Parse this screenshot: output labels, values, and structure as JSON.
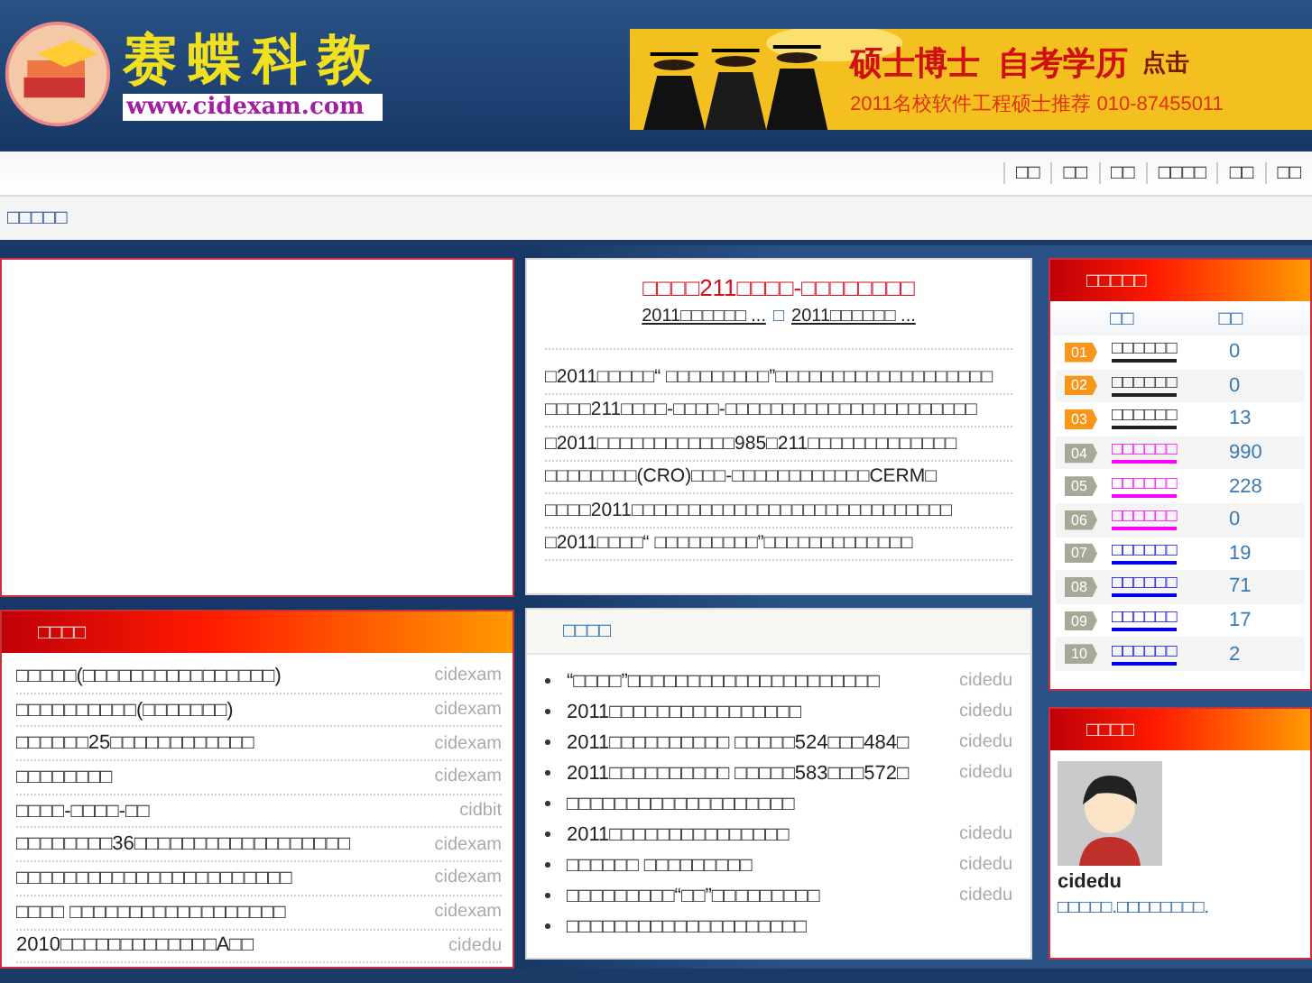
{
  "header": {
    "logo_title": "赛蝶科教",
    "logo_url": "www.cidexam.com",
    "banner": {
      "headline": "硕士博士  自考学历",
      "action": "点击",
      "subline": "2011名校软件工程硕士推荐 010-87455011"
    }
  },
  "nav": [
    "□□",
    "□□",
    "□□",
    "□□□□",
    "□□",
    "□□"
  ],
  "breadcrumb": "□□□□□",
  "article": {
    "title": "□□□□211□□□□-□□□□□□□□",
    "links": [
      "2011□□□□□□ ...",
      "2011□□□□□□ ..."
    ],
    "separator": "□",
    "lines": [
      "□2011□□□□□“ □□□□□□□□□”□□□□□□□□□□□□□□□□□□□",
      "□□□□211□□□□-□□□□-□□□□□□□□□□□□□□□□□□□□□□",
      "□2011□□□□□□□□□□□□985□211□□□□□□□□□□□□□",
      "□□□□□□□□(CRO)□□□-□□□□□□□□□□□□CERM□",
      "□□□□2011□□□□□□□□□□□□□□□□□□□□□□□□□□□□",
      "□2011□□□□“ □□□□□□□□□”□□□□□□□□□□□□□"
    ]
  },
  "left_list": {
    "title": "□□□□",
    "items": [
      {
        "text": "□□□□□(□□□□□□□□□□□□□□□□)",
        "author": "cidexam"
      },
      {
        "text": "□□□□□□□□□□(□□□□□□□)",
        "author": "cidexam"
      },
      {
        "text": "□□□□□□25□□□□□□□□□□□□",
        "author": "cidexam"
      },
      {
        "text": "□□□□□□□□",
        "author": "cidexam"
      },
      {
        "text": "□□□□-□□□□-□□",
        "author": "cidbit"
      },
      {
        "text": "□□□□□□□□36□□□□□□□□□□□□□□□□□□",
        "author": "cidexam"
      },
      {
        "text": "□□□□□□□□□□□□□□□□□□□□□□□",
        "author": "cidexam"
      },
      {
        "text": "□□□□ □□□□□□□□□□□□□□□□□□",
        "author": "cidexam"
      },
      {
        "text": "2010□□□□□□□□□□□□□A□□",
        "author": "cidedu"
      }
    ]
  },
  "news": {
    "title": "□□□□",
    "items": [
      {
        "text": "“□□□□”□□□□□□□□□□□□□□□□□□□□□",
        "author": "cidedu"
      },
      {
        "text": "2011□□□□□□□□□□□□□□□□",
        "author": "cidedu"
      },
      {
        "text": "2011□□□□□□□□□□ □□□□□524□□□484□",
        "author": "cidedu"
      },
      {
        "text": "2011□□□□□□□□□□ □□□□□583□□□572□",
        "author": "cidedu"
      },
      {
        "text": "□□□□□□□□□□□□□□□□□□□"
      },
      {
        "text": "2011□□□□□□□□□□□□□□□",
        "author": "cidedu"
      },
      {
        "text": "□□□□□□ □□□□□□□□□",
        "author": "cidedu"
      },
      {
        "text": "□□□□□□□□□“□□”□□□□□□□□□",
        "author": "cidedu"
      },
      {
        "text": "□□□□□□□□□□□□□□□□□□□□"
      }
    ]
  },
  "ranking": {
    "title": "□□□□□",
    "columns": [
      "□□",
      "□□"
    ],
    "items": [
      {
        "rank": "01",
        "name": "□□□□□□",
        "count": "0",
        "top": true,
        "color": "#222222"
      },
      {
        "rank": "02",
        "name": "□□□□□□",
        "count": "0",
        "top": true,
        "color": "#222222"
      },
      {
        "rank": "03",
        "name": "□□□□□□",
        "count": "13",
        "top": true,
        "color": "#222222"
      },
      {
        "rank": "04",
        "name": "□□□□□□",
        "count": "990",
        "top": false,
        "color": "#ff00ff"
      },
      {
        "rank": "05",
        "name": "□□□□□□",
        "count": "228",
        "top": false,
        "color": "#ff00ff"
      },
      {
        "rank": "06",
        "name": "□□□□□□",
        "count": "0",
        "top": false,
        "color": "#ff00ff"
      },
      {
        "rank": "07",
        "name": "□□□□□□",
        "count": "19",
        "top": false,
        "color": "#0000ee"
      },
      {
        "rank": "08",
        "name": "□□□□□□",
        "count": "71",
        "top": false,
        "color": "#0000ee"
      },
      {
        "rank": "09",
        "name": "□□□□□□",
        "count": "17",
        "top": false,
        "color": "#0000ee"
      },
      {
        "rank": "10",
        "name": "□□□□□□",
        "count": "2",
        "top": false,
        "color": "#0000ee"
      }
    ]
  },
  "profile": {
    "title": "□□□□",
    "name": "cidedu",
    "description": "□□□□□.□□□□□□□□."
  }
}
